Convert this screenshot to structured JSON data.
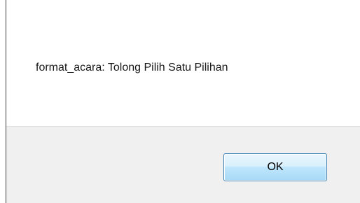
{
  "dialog": {
    "message": "format_acara: Tolong Pilih Satu Pilihan",
    "ok_label": "OK"
  }
}
